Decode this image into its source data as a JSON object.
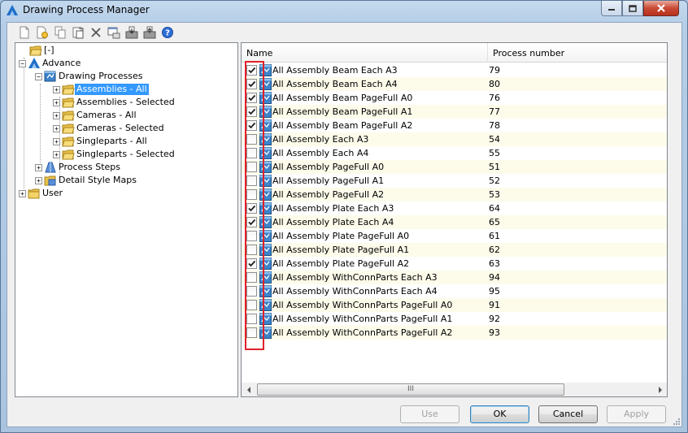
{
  "window": {
    "title": "Drawing Process Manager"
  },
  "toolbar": {
    "icons": [
      "new-icon",
      "new-from-icon",
      "copy-icon",
      "paste-icon",
      "delete-icon",
      "properties-icon",
      "import-icon",
      "export-icon",
      "help-icon"
    ]
  },
  "tree": {
    "root_label": "[-]",
    "advance_label": "Advance",
    "drawing_processes_label": "Drawing Processes",
    "children": [
      "Assemblies - All",
      "Assemblies - Selected",
      "Cameras - All",
      "Cameras - Selected",
      "Singleparts - All",
      "Singleparts - Selected"
    ],
    "selected": "Assemblies - All",
    "process_steps_label": "Process Steps",
    "detail_style_maps_label": "Detail Style Maps",
    "user_label": "User"
  },
  "list": {
    "columns": [
      "Name",
      "Process number"
    ],
    "rows": [
      {
        "name": "All Assembly Beam Each A3",
        "number": "79",
        "checked": true
      },
      {
        "name": "All Assembly Beam Each A4",
        "number": "80",
        "checked": true
      },
      {
        "name": "All Assembly Beam PageFull A0",
        "number": "76",
        "checked": true
      },
      {
        "name": "All Assembly Beam PageFull A1",
        "number": "77",
        "checked": true
      },
      {
        "name": "All Assembly Beam PageFull A2",
        "number": "78",
        "checked": true
      },
      {
        "name": "All Assembly Each A3",
        "number": "54",
        "checked": false
      },
      {
        "name": "All Assembly Each A4",
        "number": "55",
        "checked": false
      },
      {
        "name": "All Assembly PageFull A0",
        "number": "51",
        "checked": false
      },
      {
        "name": "All Assembly PageFull A1",
        "number": "52",
        "checked": false
      },
      {
        "name": "All Assembly PageFull A2",
        "number": "53",
        "checked": false
      },
      {
        "name": "All Assembly Plate Each A3",
        "number": "64",
        "checked": true
      },
      {
        "name": "All Assembly Plate Each A4",
        "number": "65",
        "checked": true
      },
      {
        "name": "All Assembly Plate PageFull A0",
        "number": "61",
        "checked": false
      },
      {
        "name": "All Assembly Plate PageFull A1",
        "number": "62",
        "checked": false
      },
      {
        "name": "All Assembly Plate PageFull A2",
        "number": "63",
        "checked": true
      },
      {
        "name": "All Assembly WithConnParts Each A3",
        "number": "94",
        "checked": false
      },
      {
        "name": "All Assembly WithConnParts Each A4",
        "number": "95",
        "checked": false
      },
      {
        "name": "All Assembly WithConnParts PageFull A0",
        "number": "91",
        "checked": false
      },
      {
        "name": "All Assembly WithConnParts PageFull A1",
        "number": "92",
        "checked": false
      },
      {
        "name": "All Assembly WithConnParts PageFull A2",
        "number": "93",
        "checked": false
      }
    ],
    "scroll_thumb_grip": "III"
  },
  "buttons": {
    "use": "Use",
    "ok": "OK",
    "cancel": "Cancel",
    "apply": "Apply"
  },
  "colors": {
    "selection": "#3399ff",
    "highlight_box": "#e0202a",
    "alt_row": "#fdfbea"
  }
}
